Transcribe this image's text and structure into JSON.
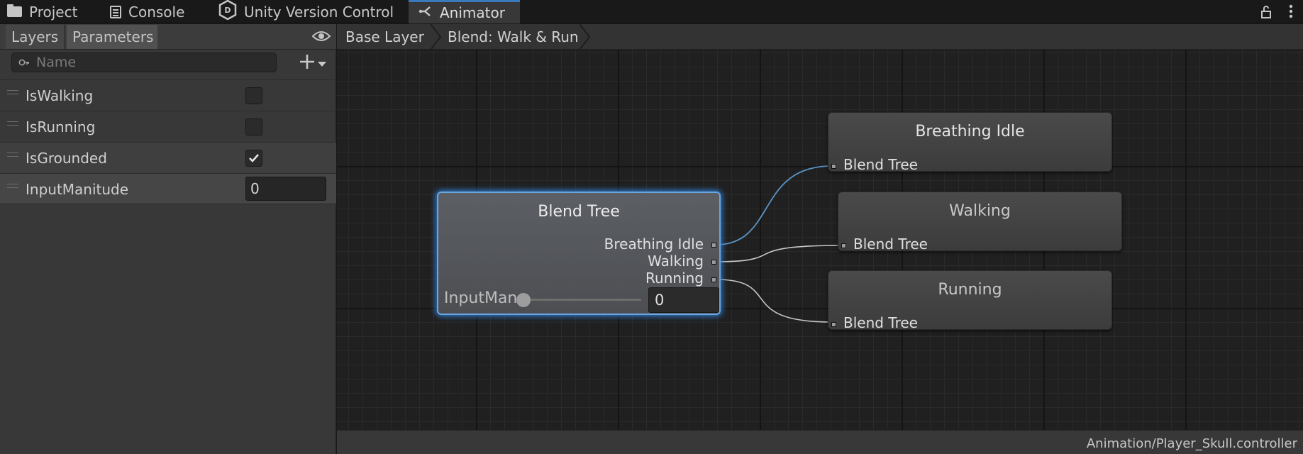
{
  "tabs": {
    "project": "Project",
    "console": "Console",
    "version_control": "Unity Version Control",
    "animator": "Animator"
  },
  "left_panel": {
    "tabs": {
      "layers": "Layers",
      "parameters": "Parameters"
    },
    "search": {
      "placeholder": "Name",
      "value": ""
    },
    "parameters": [
      {
        "name": "IsWalking",
        "type": "bool",
        "value": false
      },
      {
        "name": "IsRunning",
        "type": "bool",
        "value": false
      },
      {
        "name": "IsGrounded",
        "type": "bool",
        "value": true
      },
      {
        "name": "InputManitude",
        "type": "float",
        "value": "0"
      }
    ]
  },
  "breadcrumb": {
    "base": "Base Layer",
    "current": "Blend: Walk & Run"
  },
  "graph": {
    "blend_tree": {
      "title": "Blend Tree",
      "outputs": [
        "Breathing Idle",
        "Walking",
        "Running"
      ],
      "param_label": "InputManitude",
      "param_value": "0",
      "slider_fraction": 0
    },
    "motions": [
      {
        "title": "Breathing Idle",
        "input": "Blend Tree"
      },
      {
        "title": "Walking",
        "input": "Blend Tree"
      },
      {
        "title": "Running",
        "input": "Blend Tree"
      }
    ]
  },
  "status": {
    "path": "Animation/Player_Skull.controller"
  },
  "colors": {
    "accent": "#3a79bb",
    "selection_glow": "#2e78c9",
    "active_edge": "#5b95c8"
  }
}
